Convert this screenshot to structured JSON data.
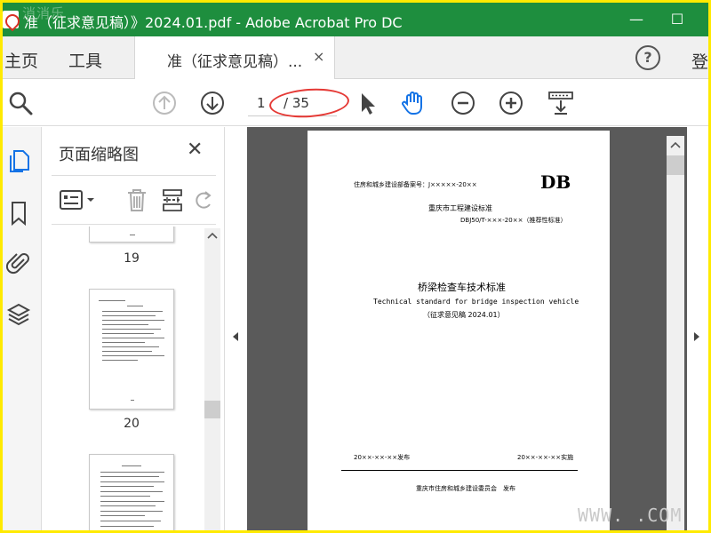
{
  "window": {
    "title": "准（征求意见稿）》2024.01.pdf - Adobe Acrobat Pro DC",
    "minimize": "—",
    "maximize": "☐",
    "watermark_top": "消消乐"
  },
  "tabbar": {
    "home": "主页",
    "tools": "工具",
    "doc_tab": "准（征求意见稿）...",
    "doc_tab_close": "×",
    "help": "?",
    "login": "登"
  },
  "toolbar": {
    "page_current": "1",
    "page_total": "/ 35"
  },
  "thumbnails": {
    "title": "页面缩略图",
    "close": "✕",
    "pages": [
      {
        "label": "19"
      },
      {
        "label": "20"
      }
    ]
  },
  "document": {
    "header_left": "住房和城乡建设部备案号：J×××××-20××",
    "header_right": "DB",
    "org": "重庆市工程建设标准",
    "code": "DBJ50/T-×××-20××（推荐性标准）",
    "title_cn": "桥梁检查车技术标准",
    "title_en": "Technical standard for bridge inspection vehicle",
    "draft": "（征求意见稿 2024.01）",
    "issue_date": "20××-××-××发布",
    "impl_date": "20××-××-××实施",
    "publisher": "重庆市住房和城乡建设委员会　发布"
  },
  "footer": {
    "watermark": "WWW.      .COM"
  },
  "colors": {
    "title_bar": "#1e8e3e",
    "border": "#ffea00",
    "annotation": "#e53935",
    "hand_tool": "#1473e6"
  }
}
